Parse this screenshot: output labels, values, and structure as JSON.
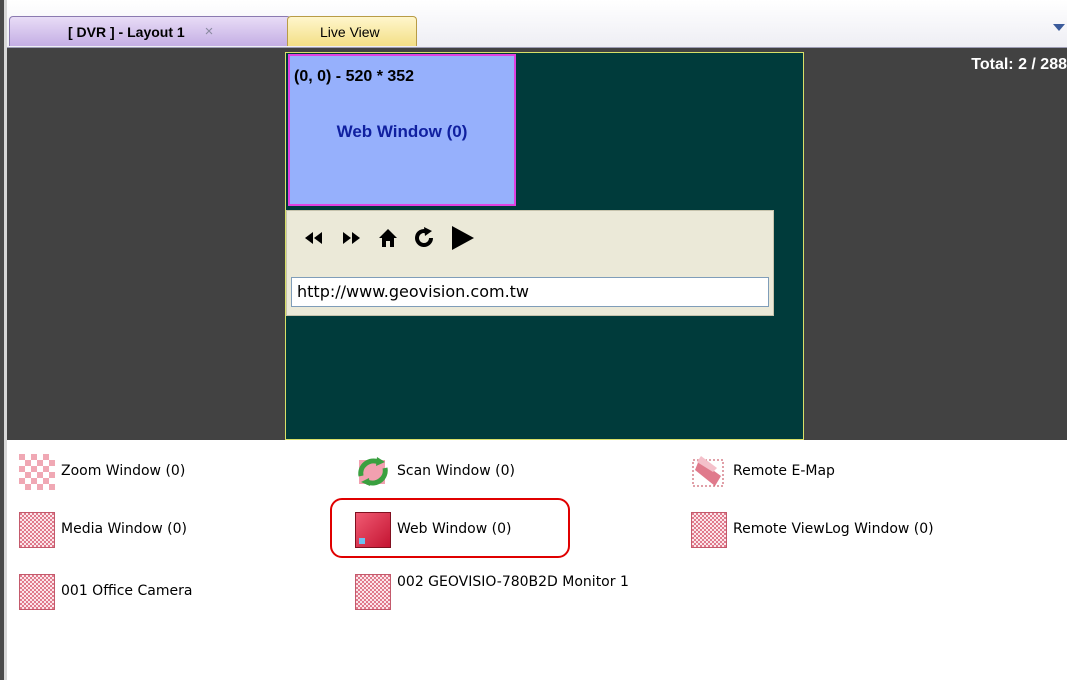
{
  "tabs": {
    "dvr_tab": "[ DVR ] - Layout 1",
    "dvr_close": "×",
    "live_tab": "Live View"
  },
  "canvas": {
    "total_label": "Total: 2 / 288",
    "web_window_coords": "(0, 0) - 520 * 352",
    "web_window_title": "Web Window (0)",
    "url_value": "http://www.geovision.com.tw",
    "nav_icons": [
      "back-icon",
      "forward-icon",
      "home-icon",
      "refresh-icon",
      "go-icon"
    ]
  },
  "items": {
    "zoom_window": "Zoom Window (0)",
    "scan_window": "Scan Window (0)",
    "remote_emap": "Remote E-Map",
    "media_window": "Media Window (0)",
    "web_window": "Web Window (0)",
    "remote_viewlog": "Remote ViewLog Window (0)",
    "camera_001": "001 Office Camera",
    "monitor_002": "002 GEOVISIO-780B2D Monitor 1"
  },
  "colors": {
    "canvas_bg": "#424242",
    "monitor_bg": "#003b3b",
    "web_window_bg": "#96b0fc",
    "highlight": "#e00000"
  }
}
